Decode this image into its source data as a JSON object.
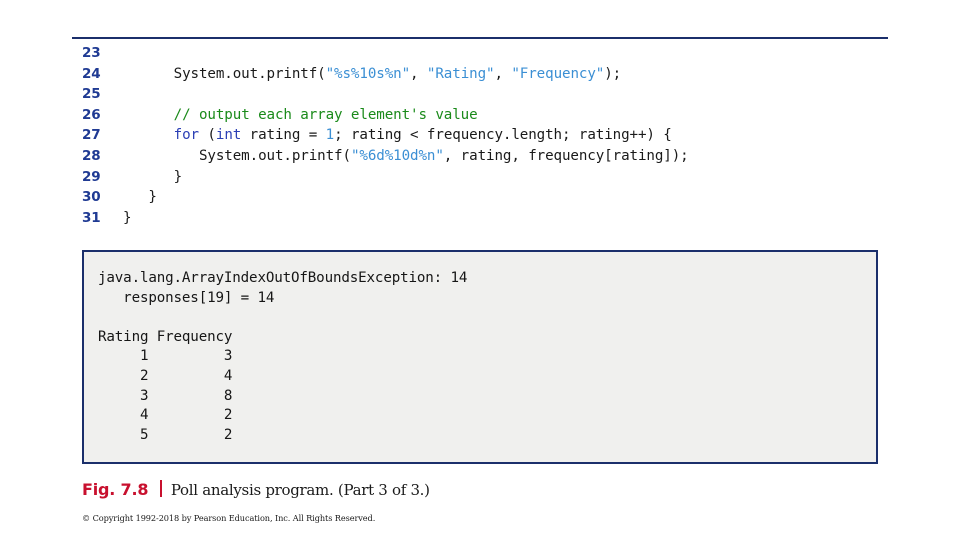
{
  "colors": {
    "rule": "#1b2f6b",
    "line_number": "#1f3a93",
    "keyword": "#2b3fb5",
    "string": "#3b8fd4",
    "comment": "#1a8a1a",
    "code_plain": "#1a1a1a",
    "caption_red": "#c8102e",
    "output_background": "#f0f0ee",
    "output_border": "#1b2f6b"
  },
  "code": {
    "lines": [
      {
        "number": "23",
        "tokens": [
          {
            "text": "",
            "type": "plain"
          }
        ]
      },
      {
        "number": "24",
        "tokens": [
          {
            "text": "      System.out.printf(",
            "type": "plain"
          },
          {
            "text": "\"%s%10s%n\"",
            "type": "string"
          },
          {
            "text": ", ",
            "type": "plain"
          },
          {
            "text": "\"Rating\"",
            "type": "string"
          },
          {
            "text": ", ",
            "type": "plain"
          },
          {
            "text": "\"Frequency\"",
            "type": "string"
          },
          {
            "text": ");",
            "type": "plain"
          }
        ]
      },
      {
        "number": "25",
        "tokens": [
          {
            "text": "",
            "type": "plain"
          }
        ]
      },
      {
        "number": "26",
        "tokens": [
          {
            "text": "      ",
            "type": "plain"
          },
          {
            "text": "// output each array element's value",
            "type": "comment"
          }
        ]
      },
      {
        "number": "27",
        "tokens": [
          {
            "text": "      ",
            "type": "plain"
          },
          {
            "text": "for",
            "type": "keyword"
          },
          {
            "text": " (",
            "type": "plain"
          },
          {
            "text": "int",
            "type": "keyword"
          },
          {
            "text": " rating = ",
            "type": "plain"
          },
          {
            "text": "1",
            "type": "number"
          },
          {
            "text": "; rating < frequency.length; rating++) {",
            "type": "plain"
          }
        ]
      },
      {
        "number": "28",
        "tokens": [
          {
            "text": "         System.out.printf(",
            "type": "plain"
          },
          {
            "text": "\"%6d%10d%n\"",
            "type": "string"
          },
          {
            "text": ", rating, frequency[rating]);",
            "type": "plain"
          }
        ]
      },
      {
        "number": "29",
        "tokens": [
          {
            "text": "      }",
            "type": "plain"
          }
        ]
      },
      {
        "number": "30",
        "tokens": [
          {
            "text": "   }",
            "type": "plain"
          }
        ]
      },
      {
        "number": "31",
        "tokens": [
          {
            "text": "}",
            "type": "plain"
          }
        ]
      }
    ]
  },
  "output": {
    "lines": [
      "java.lang.ArrayIndexOutOfBoundsException: 14",
      "   responses[19] = 14",
      "",
      "Rating Frequency",
      "     1         3",
      "     2         4",
      "     3         8",
      "     4         2",
      "     5         2"
    ],
    "exception": {
      "type": "java.lang.ArrayIndexOutOfBoundsException",
      "message": "14",
      "detail": "responses[19] = 14"
    },
    "table": {
      "headers": [
        "Rating",
        "Frequency"
      ],
      "rows": [
        [
          "1",
          "3"
        ],
        [
          "2",
          "4"
        ],
        [
          "3",
          "8"
        ],
        [
          "4",
          "2"
        ],
        [
          "5",
          "2"
        ]
      ]
    }
  },
  "caption": {
    "figure": "Fig. 7.8",
    "separator": "|",
    "title": "Poll analysis program. (Part 3 of 3.)"
  },
  "footer": {
    "copyright": "© Copyright 1992-2018 by Pearson Education, Inc. All Rights Reserved."
  }
}
